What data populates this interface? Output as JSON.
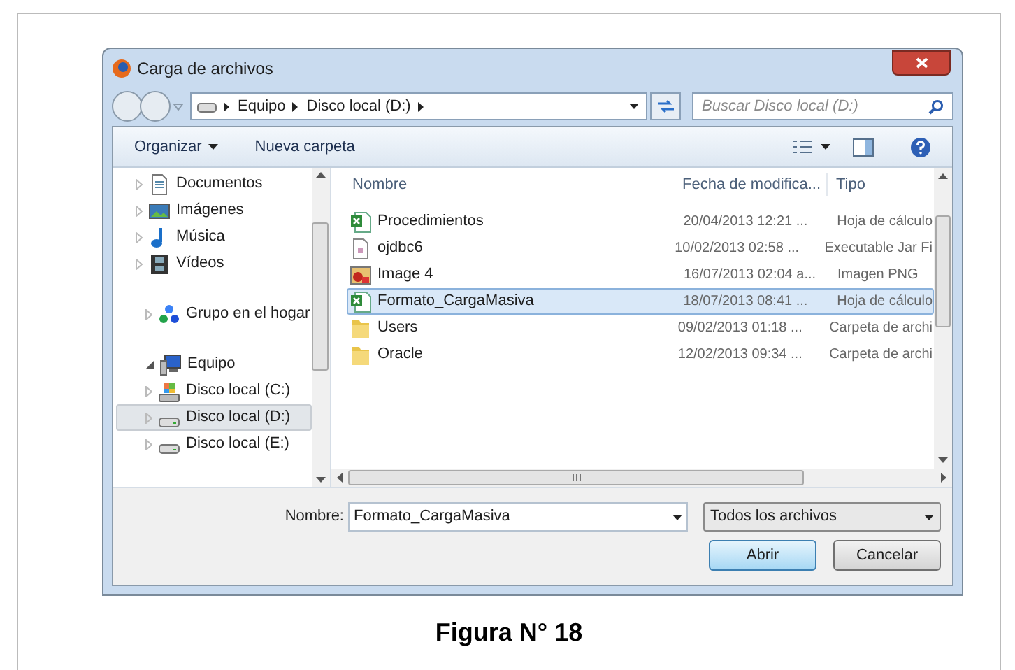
{
  "window": {
    "title": "Carga de archivos"
  },
  "address": {
    "path": [
      "Equipo",
      "Disco local (D:)"
    ]
  },
  "search": {
    "placeholder": "Buscar Disco local (D:)"
  },
  "toolbar": [
    {
      "label": "Organizar",
      "dropdown": true
    },
    {
      "label": "Nueva carpeta",
      "dropdown": false
    }
  ],
  "nav": [
    {
      "label": "Documentos",
      "kind": "document",
      "selected": false,
      "expanded": false
    },
    {
      "label": "Imágenes",
      "kind": "pictures",
      "selected": false,
      "expanded": false
    },
    {
      "label": "Música",
      "kind": "music",
      "selected": false,
      "expanded": false
    },
    {
      "label": "Vídeos",
      "kind": "video",
      "selected": false,
      "expanded": false
    },
    {
      "label": "Grupo en el hogar",
      "kind": "homegroup",
      "selected": false,
      "expanded": false
    },
    {
      "label": "Equipo",
      "kind": "computer",
      "selected": false,
      "expanded": true,
      "children": [
        {
          "label": "Disco local (C:)",
          "kind": "systemdrive",
          "selected": false,
          "expanded": false
        },
        {
          "label": "Disco local (D:)",
          "kind": "drive",
          "selected": true,
          "expanded": false
        },
        {
          "label": "Disco local (E:)",
          "kind": "drive",
          "selected": false,
          "expanded": false
        }
      ]
    }
  ],
  "columns": [
    "Nombre",
    "Fecha de modifica...",
    "Tipo"
  ],
  "files": [
    {
      "name": "Procedimientos",
      "date": "20/04/2013 12:21 ...",
      "type": "Hoja de cálculo",
      "kind": "sheet",
      "selected": false
    },
    {
      "name": "ojdbc6",
      "date": "10/02/2013 02:58 ...",
      "type": "Executable Jar Fi",
      "kind": "jar",
      "selected": false
    },
    {
      "name": "Image 4",
      "date": "16/07/2013 02:04 a...",
      "type": "Imagen PNG",
      "kind": "image",
      "selected": false
    },
    {
      "name": "Formato_CargaMasiva",
      "date": "18/07/2013 08:41 ...",
      "type": "Hoja de cálculo",
      "kind": "sheet",
      "selected": true
    },
    {
      "name": "Users",
      "date": "09/02/2013 01:18 ...",
      "type": "Carpeta de archi",
      "kind": "folder",
      "selected": false
    },
    {
      "name": "Oracle",
      "date": "12/02/2013 09:34 ...",
      "type": "Carpeta de archi",
      "kind": "folder",
      "selected": false
    }
  ],
  "filename": {
    "label": "Nombre:",
    "value": "Formato_CargaMasiva"
  },
  "filter": {
    "value": "Todos los archivos"
  },
  "buttons": [
    {
      "label": "Abrir",
      "default": true
    },
    {
      "label": "Cancelar",
      "default": false
    }
  ],
  "caption": "Figura N° 18"
}
